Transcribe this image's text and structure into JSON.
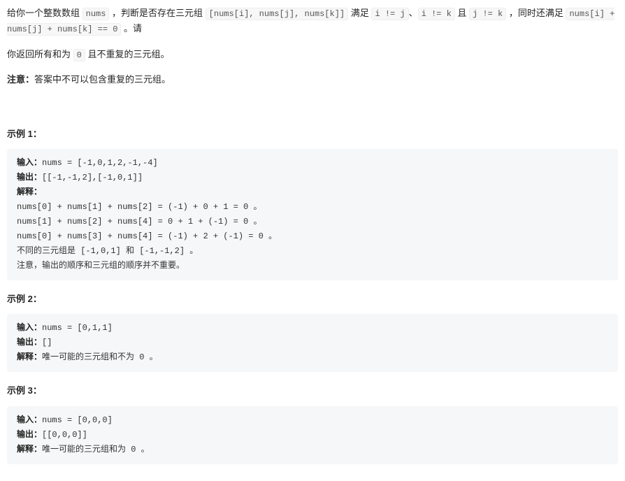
{
  "intro": {
    "p1_a": "给你一个整数数组 ",
    "c_nums": "nums",
    "p1_b": " ，判断是否存在三元组 ",
    "c_triple": "[nums[i], nums[j], nums[k]]",
    "p1_c": " 满足 ",
    "c_ij": "i != j",
    "p1_d": "、",
    "c_ik": "i != k",
    "p1_e": " 且 ",
    "c_jk": "j != k",
    "p1_f": " ，同时还满足 ",
    "c_sum": "nums[i] + nums[j] + nums[k] == 0",
    "p1_g": " 。请"
  },
  "line2": {
    "a": "你返回所有和为 ",
    "c_zero": "0",
    "b": " 且不重复的三元组。"
  },
  "notice": {
    "label": "注意：",
    "text": "答案中不可以包含重复的三元组。"
  },
  "ex1": {
    "head": "示例 1：",
    "input_label": "输入：",
    "input_val": "nums = [-1,0,1,2,-1,-4]",
    "output_label": "输出：",
    "output_val": "[[-1,-1,2],[-1,0,1]]",
    "explain_label": "解释：",
    "line1": "nums[0] + nums[1] + nums[2] = (-1) + 0 + 1 = 0 。",
    "line2": "nums[1] + nums[2] + nums[4] = 0 + 1 + (-1) = 0 。",
    "line3": "nums[0] + nums[3] + nums[4] = (-1) + 2 + (-1) = 0 。",
    "line4": "不同的三元组是 [-1,0,1] 和 [-1,-1,2] 。",
    "line5": "注意，输出的顺序和三元组的顺序并不重要。"
  },
  "ex2": {
    "head": "示例 2：",
    "input_label": "输入：",
    "input_val": "nums = [0,1,1]",
    "output_label": "输出：",
    "output_val": "[]",
    "explain_label": "解释：",
    "explain_val": "唯一可能的三元组和不为 0 。"
  },
  "ex3": {
    "head": "示例 3：",
    "input_label": "输入：",
    "input_val": "nums = [0,0,0]",
    "output_label": "输出：",
    "output_val": "[[0,0,0]]",
    "explain_label": "解释：",
    "explain_val": "唯一可能的三元组和为 0 。"
  }
}
